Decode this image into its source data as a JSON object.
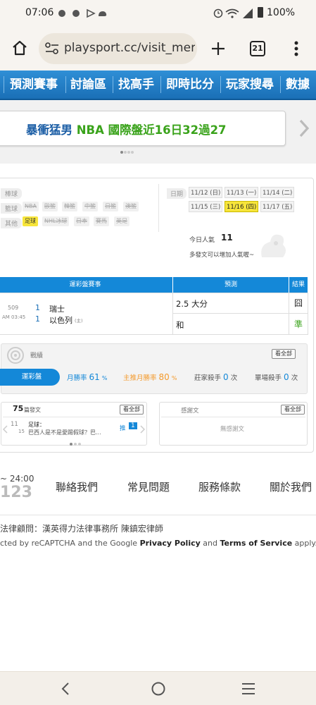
{
  "status": {
    "time": "07:06",
    "battery": "100%"
  },
  "browser": {
    "url": "playsport.cc/visit_mer",
    "tab_count": "21"
  },
  "nav": {
    "items": [
      "預測賽事",
      "討論區",
      "找高手",
      "即時比分",
      "玩家搜尋",
      "數據"
    ]
  },
  "banner": {
    "text_blue": "暴衝猛男",
    "text_green": "NBA 國際盤近16日32過27"
  },
  "filters": {
    "baseball_label": "棒球",
    "basketball_label": "籃球",
    "basketball_items": [
      "NBA",
      "歐籃",
      "韓籃",
      "中籃",
      "日籃",
      "澳籃"
    ],
    "other_label": "其他",
    "other_items": [
      "足球",
      "NHL冰球",
      "日本",
      "賽馬",
      "英足"
    ],
    "date_label": "日期",
    "dates": [
      "11/12 (日)",
      "11/13 (一)",
      "11/14 (二)",
      "11/15 (三)",
      "11/16 (四)",
      "11/17 (五)"
    ],
    "today_label": "今日人氣",
    "today_value": "11",
    "today_hint": "多發文可以增加人氣喔~"
  },
  "table": {
    "headers": [
      "運彩盤賽事",
      "預測",
      "結果"
    ],
    "game_no": "509",
    "game_time": "AM 03:45",
    "team1_no": "1",
    "team1": "瑞士",
    "team2_no": "1",
    "team2": "以色列",
    "home_mark": "(主)",
    "pred1": "2.5 大分",
    "result1": "囧",
    "pred2": "和",
    "result2": "準"
  },
  "record": {
    "title": "戰績",
    "view_all": "看全部",
    "tab": "運彩盤",
    "monthly_label": "月勝率",
    "monthly_value": "61",
    "main_label": "主推月勝率",
    "main_value": "80",
    "pct": "%",
    "dealer_label": "莊家殺手",
    "dealer_value": "0",
    "single_label": "單場殺手",
    "single_value": "0",
    "times": "次"
  },
  "posts": {
    "count": "75",
    "label": "篇發文",
    "view_all": "看全部",
    "date1": "11",
    "date2": "15",
    "category": "足球：",
    "title": "巴西人是不是愛踢假球？巴...",
    "push_label": "推",
    "push_count": "1",
    "thanks_title": "感謝文",
    "thanks_view_all": "看全部",
    "no_thanks": "無感謝文"
  },
  "footer": {
    "hours": "~ 24:00",
    "phone_part": "123",
    "links": [
      "聯絡我們",
      "常見問題",
      "服務條款",
      "關於我們"
    ],
    "legal": "法律顧問：漢英得力法律事務所 陳鎮宏律師",
    "captcha_prefix": "cted by reCAPTCHA and the Google",
    "privacy": "Privacy Policy",
    "and": "and",
    "terms": "Terms of Service",
    "apply": "apply."
  }
}
